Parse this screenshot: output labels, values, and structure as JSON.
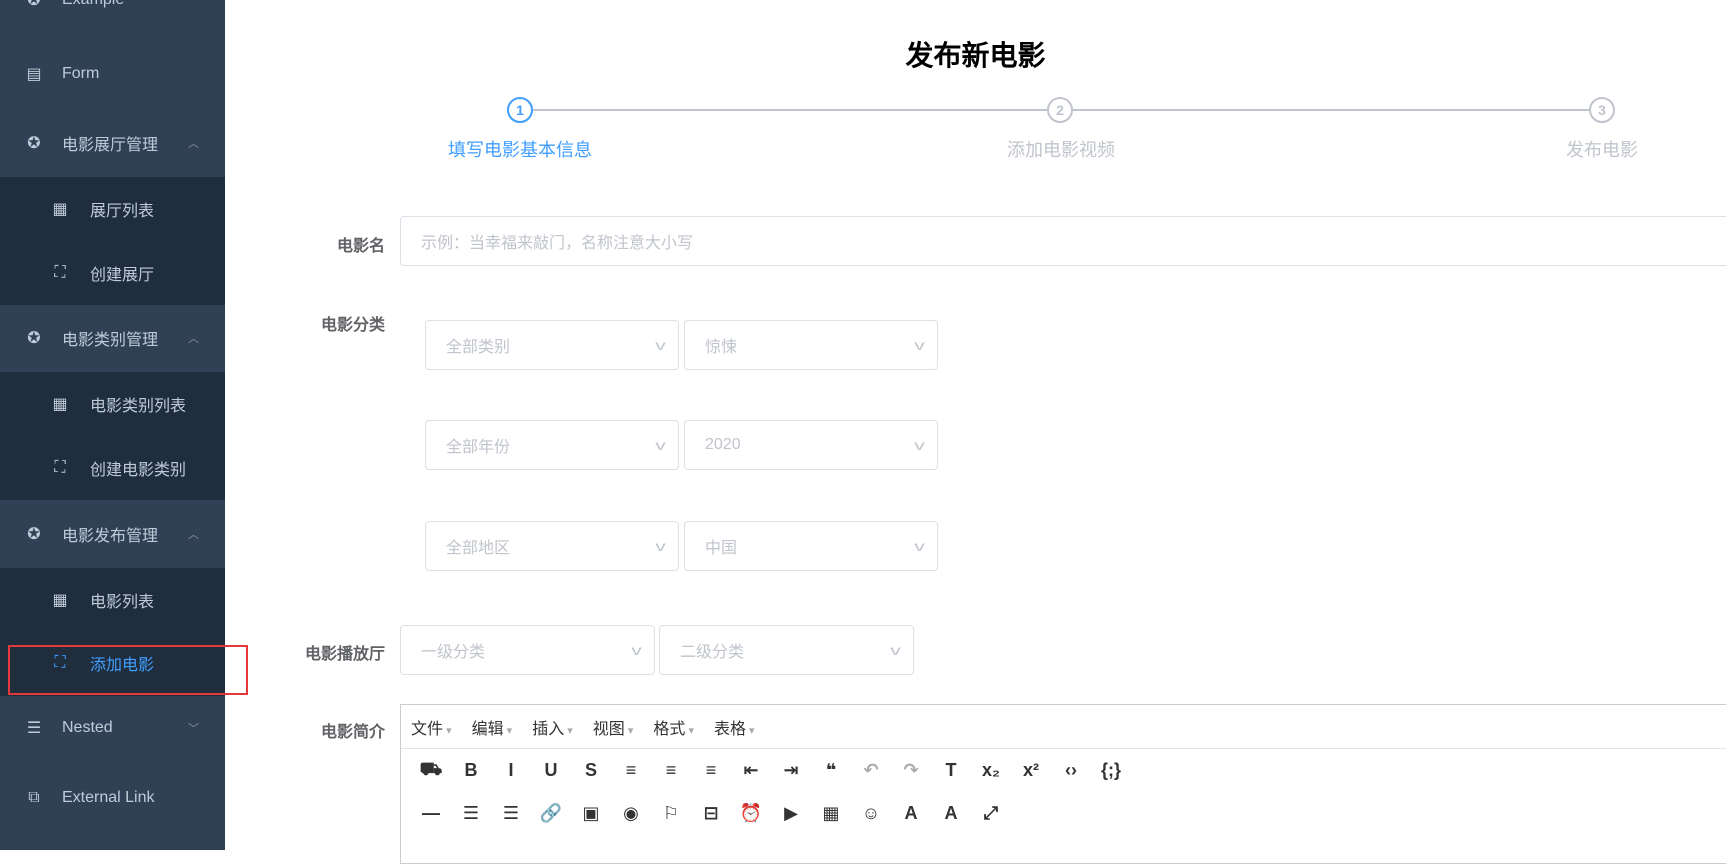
{
  "sidebar": {
    "items": [
      {
        "label": "Example",
        "icon": "component-icon",
        "chevron": "down"
      },
      {
        "label": "Form",
        "icon": "form-icon"
      },
      {
        "label": "电影展厅管理",
        "icon": "component-icon",
        "chevron": "up"
      },
      {
        "label": "展厅列表",
        "icon": "table-icon"
      },
      {
        "label": "创建展厅",
        "icon": "tree-icon"
      },
      {
        "label": "电影类别管理",
        "icon": "component-icon",
        "chevron": "up"
      },
      {
        "label": "电影类别列表",
        "icon": "table-icon"
      },
      {
        "label": "创建电影类别",
        "icon": "tree-icon"
      },
      {
        "label": "电影发布管理",
        "icon": "component-icon",
        "chevron": "up"
      },
      {
        "label": "电影列表",
        "icon": "table-icon"
      },
      {
        "label": "添加电影",
        "icon": "tree-icon",
        "active": true
      },
      {
        "label": "Nested",
        "icon": "nested-icon",
        "chevron": "down"
      },
      {
        "label": "External Link",
        "icon": "link-icon"
      }
    ]
  },
  "page": {
    "title": "发布新电影"
  },
  "steps": [
    {
      "num": "1",
      "label": "填写电影基本信息",
      "active": true
    },
    {
      "num": "2",
      "label": "添加电影视频"
    },
    {
      "num": "3",
      "label": "发布电影"
    }
  ],
  "form": {
    "name_label": "电影名",
    "name_placeholder": "示例：当幸福来敲门，名称注意大小写",
    "category_label": "电影分类",
    "selects": [
      "全部类别",
      "惊悚",
      "全部年份",
      "2020",
      "全部地区",
      "中国"
    ],
    "hall_label": "电影播放厅",
    "hall_selects": [
      "一级分类",
      "二级分类"
    ],
    "intro_label": "电影简介"
  },
  "editor": {
    "menus": [
      "文件",
      "编辑",
      "插入",
      "视图",
      "格式",
      "表格"
    ]
  },
  "colors": {
    "sidebar": "#304156",
    "submenu": "#1f2d3d",
    "accent": "#409eff",
    "highlight": "#e4393c"
  }
}
